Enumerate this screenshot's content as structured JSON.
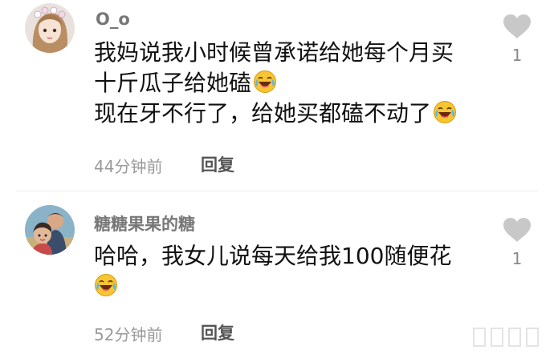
{
  "comments": [
    {
      "username": "O_o",
      "lines": [
        "我妈说我小时候曾承诺给她每个月买",
        "十斤瓜子给她磕",
        "现在牙不行了，给她买都磕不动了"
      ],
      "time": "44分钟前",
      "reply_label": "回复",
      "like_count": "1",
      "like_icon": "heart-icon",
      "emoji": "laughing-crying-emoji"
    },
    {
      "username": "糖糖果果的糖",
      "lines": [
        "哈哈，我女儿说每天给我100随便花"
      ],
      "time": "52分钟前",
      "reply_label": "回复",
      "like_count": "1",
      "like_icon": "heart-icon",
      "emoji": "laughing-crying-emoji"
    }
  ],
  "colors": {
    "username": "#777777",
    "meta": "#9a9a9a",
    "heart": "#c8c8c8",
    "emoji_face": "#f7c531"
  }
}
